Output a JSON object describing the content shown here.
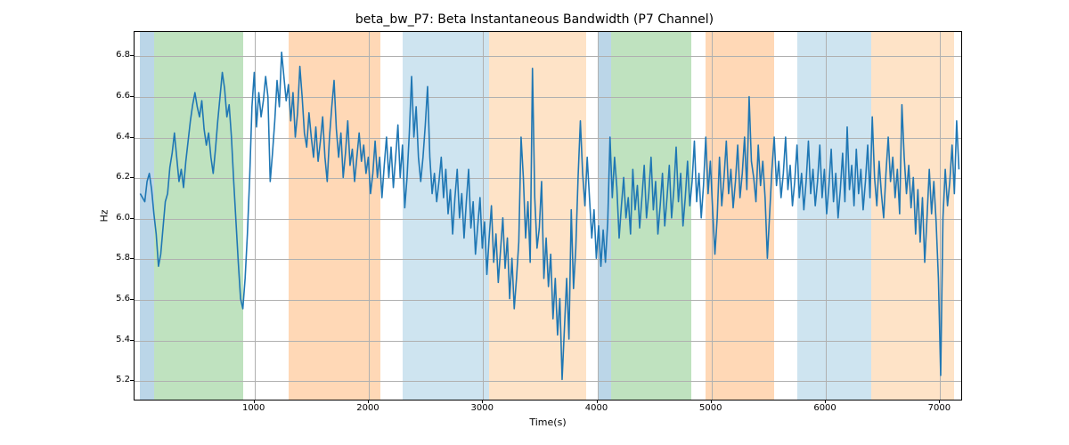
{
  "chart_data": {
    "type": "line",
    "title": "beta_bw_P7: Beta Instantaneous Bandwidth (P7 Channel)",
    "xlabel": "Time(s)",
    "ylabel": "Hz",
    "xlim": [
      -50,
      7200
    ],
    "ylim": [
      5.1,
      6.92
    ],
    "xticks": [
      1000,
      2000,
      3000,
      4000,
      5000,
      6000,
      7000
    ],
    "yticks": [
      5.2,
      5.4,
      5.6,
      5.8,
      6.0,
      6.2,
      6.4,
      6.6,
      6.8
    ],
    "bands": [
      {
        "x0": 0,
        "x1": 120,
        "color": "blue"
      },
      {
        "x0": 120,
        "x1": 900,
        "color": "green"
      },
      {
        "x0": 1300,
        "x1": 2100,
        "color": "orange"
      },
      {
        "x0": 2300,
        "x1": 3050,
        "color": "lblue"
      },
      {
        "x0": 3050,
        "x1": 3900,
        "color": "lorange"
      },
      {
        "x0": 4000,
        "x1": 4120,
        "color": "blue"
      },
      {
        "x0": 4120,
        "x1": 4820,
        "color": "green"
      },
      {
        "x0": 4950,
        "x1": 5550,
        "color": "orange"
      },
      {
        "x0": 5750,
        "x1": 6400,
        "color": "lblue"
      },
      {
        "x0": 6400,
        "x1": 7120,
        "color": "lorange"
      }
    ],
    "series": [
      {
        "name": "beta_bw_P7",
        "x_interval": 20,
        "y": [
          6.12,
          6.1,
          6.08,
          6.18,
          6.22,
          6.14,
          6.02,
          5.92,
          5.76,
          5.82,
          5.95,
          6.08,
          6.12,
          6.25,
          6.32,
          6.42,
          6.3,
          6.18,
          6.24,
          6.15,
          6.28,
          6.38,
          6.48,
          6.56,
          6.62,
          6.55,
          6.5,
          6.58,
          6.44,
          6.36,
          6.42,
          6.3,
          6.22,
          6.34,
          6.48,
          6.6,
          6.72,
          6.64,
          6.5,
          6.56,
          6.4,
          6.18,
          5.98,
          5.78,
          5.6,
          5.55,
          5.7,
          5.92,
          6.2,
          6.55,
          6.72,
          6.45,
          6.62,
          6.5,
          6.58,
          6.7,
          6.6,
          6.18,
          6.32,
          6.48,
          6.68,
          6.55,
          6.82,
          6.7,
          6.58,
          6.66,
          6.48,
          6.62,
          6.4,
          6.52,
          6.75,
          6.6,
          6.42,
          6.35,
          6.52,
          6.4,
          6.3,
          6.45,
          6.28,
          6.38,
          6.5,
          6.3,
          6.18,
          6.4,
          6.55,
          6.68,
          6.44,
          6.3,
          6.42,
          6.2,
          6.32,
          6.48,
          6.26,
          6.34,
          6.18,
          6.3,
          6.42,
          6.28,
          6.36,
          6.22,
          6.3,
          6.12,
          6.22,
          6.38,
          6.2,
          6.3,
          6.1,
          6.26,
          6.4,
          6.2,
          6.35,
          6.15,
          6.3,
          6.46,
          6.2,
          6.36,
          6.05,
          6.2,
          6.42,
          6.7,
          6.4,
          6.55,
          6.3,
          6.18,
          6.3,
          6.46,
          6.65,
          6.3,
          6.12,
          6.22,
          6.08,
          6.18,
          6.3,
          6.1,
          6.24,
          6.02,
          6.14,
          5.92,
          6.1,
          6.24,
          6.0,
          6.12,
          5.9,
          6.08,
          6.24,
          5.95,
          6.08,
          5.82,
          5.96,
          6.1,
          5.85,
          5.98,
          5.72,
          5.9,
          6.06,
          5.78,
          5.92,
          5.68,
          5.84,
          6.0,
          5.75,
          5.9,
          5.6,
          5.8,
          5.55,
          5.7,
          5.88,
          6.4,
          6.2,
          5.9,
          6.08,
          5.78,
          6.74,
          6.1,
          5.85,
          5.95,
          6.18,
          5.7,
          5.9,
          5.66,
          5.82,
          5.5,
          5.7,
          5.42,
          5.6,
          5.2,
          5.45,
          5.7,
          5.4,
          6.04,
          5.65,
          5.85,
          6.2,
          6.48,
          6.22,
          6.06,
          6.3,
          6.1,
          5.9,
          6.04,
          5.8,
          5.96,
          5.76,
          5.94,
          5.78,
          5.98,
          6.4,
          6.1,
          6.3,
          6.15,
          5.9,
          6.06,
          6.2,
          6.0,
          6.1,
          5.92,
          6.24,
          6.04,
          6.16,
          5.95,
          6.1,
          6.26,
          6.0,
          6.12,
          6.3,
          6.04,
          6.18,
          5.92,
          6.06,
          6.22,
          5.96,
          6.1,
          6.26,
          6.0,
          6.14,
          6.35,
          6.08,
          6.22,
          5.96,
          6.1,
          6.28,
          6.06,
          6.18,
          6.38,
          6.08,
          6.22,
          6.0,
          6.16,
          6.4,
          6.12,
          6.28,
          6.04,
          5.82,
          6.0,
          6.3,
          6.06,
          6.2,
          6.38,
          6.12,
          6.24,
          6.05,
          6.18,
          6.36,
          6.1,
          6.22,
          6.4,
          6.14,
          6.6,
          6.28,
          6.2,
          6.08,
          6.36,
          6.16,
          6.28,
          6.1,
          5.8,
          6.02,
          6.24,
          6.4,
          6.16,
          6.28,
          6.1,
          6.22,
          6.4,
          6.14,
          6.26,
          6.06,
          6.18,
          6.36,
          6.1,
          6.22,
          6.04,
          6.18,
          6.38,
          6.12,
          6.24,
          6.06,
          6.18,
          6.36,
          6.1,
          6.24,
          6.02,
          6.16,
          6.34,
          6.08,
          6.22,
          6.0,
          6.14,
          6.32,
          6.08,
          6.45,
          6.14,
          6.26,
          6.06,
          6.34,
          6.12,
          6.24,
          6.04,
          6.18,
          6.36,
          6.1,
          6.5,
          6.2,
          6.06,
          6.28,
          6.12,
          6.0,
          6.22,
          6.4,
          6.18,
          6.3,
          6.1,
          6.24,
          6.02,
          6.56,
          6.3,
          6.12,
          6.26,
          6.05,
          6.2,
          5.92,
          6.14,
          5.88,
          6.1,
          5.78,
          6.0,
          6.24,
          6.02,
          6.18,
          5.98,
          5.7,
          5.22,
          6.0,
          6.24,
          6.06,
          6.18,
          6.36,
          6.12,
          6.48,
          6.24
        ]
      }
    ]
  }
}
